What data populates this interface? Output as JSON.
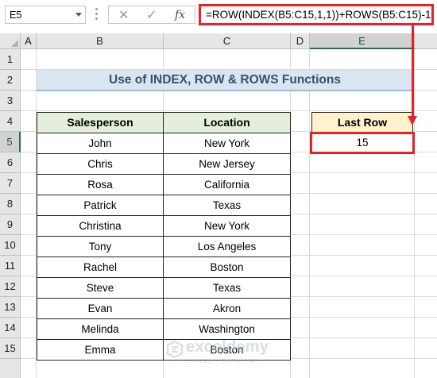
{
  "formula_bar": {
    "name_box": "E5",
    "cancel_symbol": "✕",
    "enter_symbol": "✓",
    "fx_symbol": "fx",
    "formula": "=ROW(INDEX(B5:C15,1,1))+ROWS(B5:C15)-1"
  },
  "columns": [
    "A",
    "B",
    "C",
    "D",
    "E"
  ],
  "selected_column": "E",
  "rows": [
    "1",
    "2",
    "3",
    "4",
    "5",
    "6",
    "7",
    "8",
    "9",
    "10",
    "11",
    "12",
    "13",
    "14",
    "15"
  ],
  "selected_row": "5",
  "title": "Use of INDEX, ROW & ROWS Functions",
  "table": {
    "headers": [
      "Salesperson",
      "Location"
    ],
    "rows": [
      [
        "John",
        "New York"
      ],
      [
        "Chris",
        "New Jersey"
      ],
      [
        "Rosa",
        "California"
      ],
      [
        "Patrick",
        "Texas"
      ],
      [
        "Christina",
        "New York"
      ],
      [
        "Tony",
        "Los Angeles"
      ],
      [
        "Rachel",
        "Boston"
      ],
      [
        "Steve",
        "Texas"
      ],
      [
        "Evan",
        "Akron"
      ],
      [
        "Melinda",
        "Washington"
      ],
      [
        "Emma",
        "Boston"
      ]
    ]
  },
  "result": {
    "header": "Last Row",
    "value": "15"
  },
  "watermark": {
    "name": "exceldemy",
    "tagline": "EXCEL · DATA · BI"
  },
  "colors": {
    "highlight_red": "#e8202a",
    "title_bg": "#d9e5f1",
    "title_text": "#36526e",
    "table_header_bg": "#e2efd9",
    "result_header_bg": "#fff2cc",
    "excel_green": "#217346"
  }
}
